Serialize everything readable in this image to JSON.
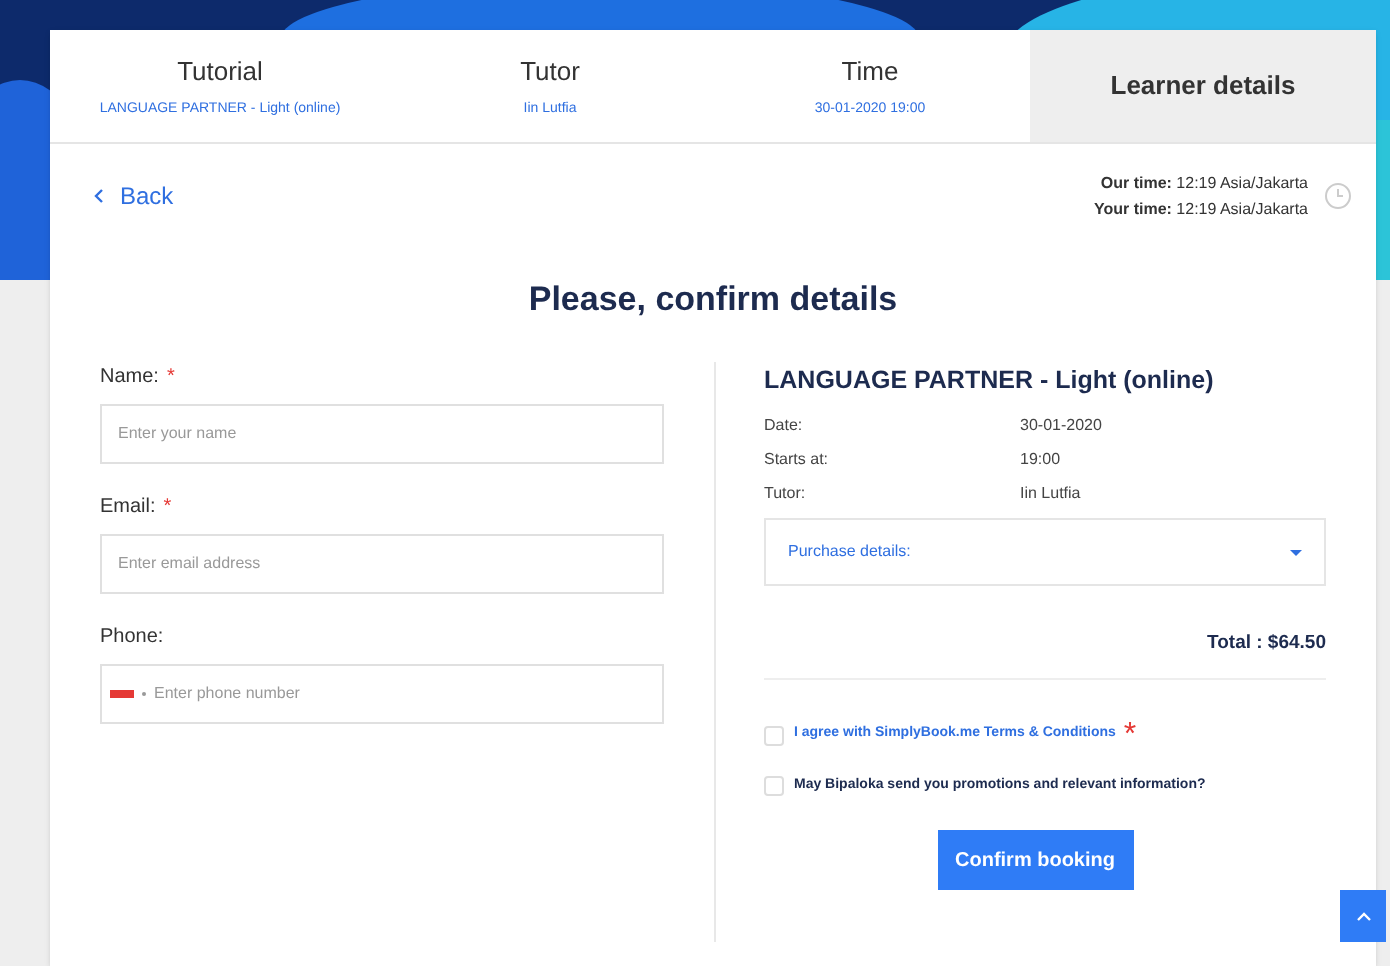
{
  "steps": [
    {
      "label": "Tutorial",
      "value": "LANGUAGE PARTNER - Light (online)",
      "selected": false
    },
    {
      "label": "Tutor",
      "value": "Iin Lutfia",
      "selected": false
    },
    {
      "label": "Time",
      "value": "30-01-2020 19:00",
      "selected": false
    },
    {
      "label": "Learner details",
      "selected": true
    }
  ],
  "back": "Back",
  "required_mark": "*",
  "times": [
    {
      "label": "Our time:",
      "value": "12:19 Asia/Jakarta"
    },
    {
      "label": "Your time:",
      "value": "12:19 Asia/Jakarta"
    }
  ],
  "heading": "Please, confirm details",
  "fields": [
    {
      "label": "Name:",
      "required": true,
      "placeholder": "Enter your name",
      "kind": "text"
    },
    {
      "label": "Email:",
      "required": true,
      "placeholder": "Enter email address",
      "kind": "text"
    },
    {
      "label": "Phone:",
      "required": false,
      "placeholder": "Enter phone number",
      "kind": "phone"
    }
  ],
  "summary": {
    "title": "LANGUAGE PARTNER - Light (online)",
    "rows": [
      {
        "label": "Date:",
        "value": "30-01-2020"
      },
      {
        "label": "Starts at:",
        "value": "19:00"
      },
      {
        "label": "Tutor:",
        "value": "Iin Lutfia"
      }
    ],
    "purchase": "Purchase details:",
    "total": "Total : $64.50"
  },
  "agreements": [
    {
      "text": "I agree with SimplyBook.me Terms & Conditions",
      "kind": "link",
      "required": true,
      "checked": false
    },
    {
      "text": "May Bipaloka send you promotions and relevant information?",
      "kind": "plain",
      "required": false,
      "checked": false
    }
  ],
  "confirm": "Confirm booking"
}
